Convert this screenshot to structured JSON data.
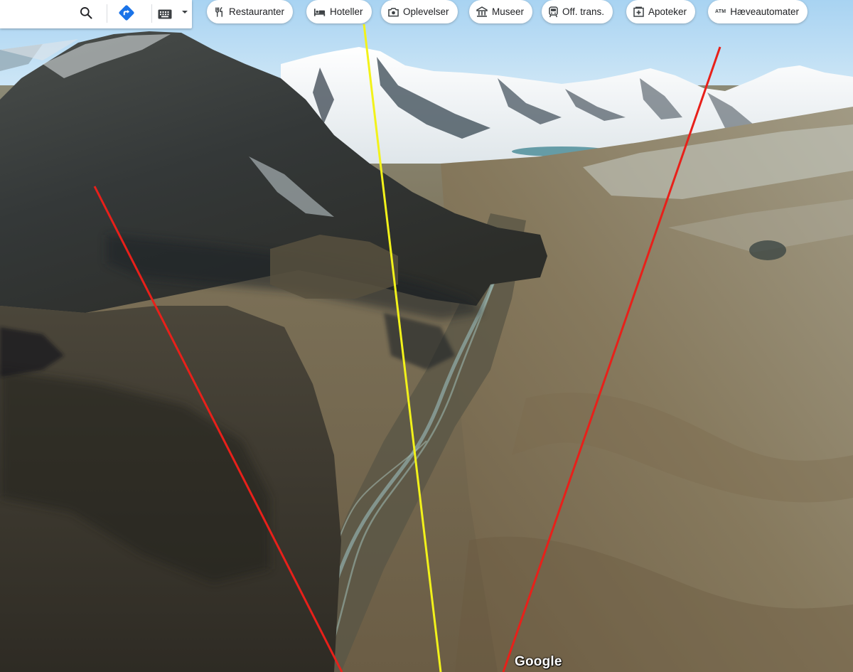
{
  "map": {
    "view": "3d-terrain",
    "attribution": "Google"
  },
  "toolbar": {
    "search_icon": "search-icon",
    "directions_icon": "directions-icon",
    "keyboard_icon": "keyboard-icon",
    "dropdown_icon": "caret-down-icon"
  },
  "chips": [
    {
      "label": "Restauranter",
      "icon": "restaurant-icon"
    },
    {
      "label": "Hoteller",
      "icon": "hotel-icon"
    },
    {
      "label": "Oplevelser",
      "icon": "camera-icon"
    },
    {
      "label": "Museer",
      "icon": "museum-icon"
    },
    {
      "label": "Off. trans.",
      "icon": "transit-icon"
    },
    {
      "label": "Apoteker",
      "icon": "pharmacy-icon"
    },
    {
      "label": "Hæveautomater",
      "icon": "atm-icon",
      "glyph": "ATM"
    }
  ],
  "overlay_lines": {
    "colors": {
      "left": "#e8201a",
      "center": "#f2f21a",
      "right": "#e8201a"
    }
  },
  "colors": {
    "directions_blue": "#1a73e8",
    "sky": "#c5e1f3"
  }
}
